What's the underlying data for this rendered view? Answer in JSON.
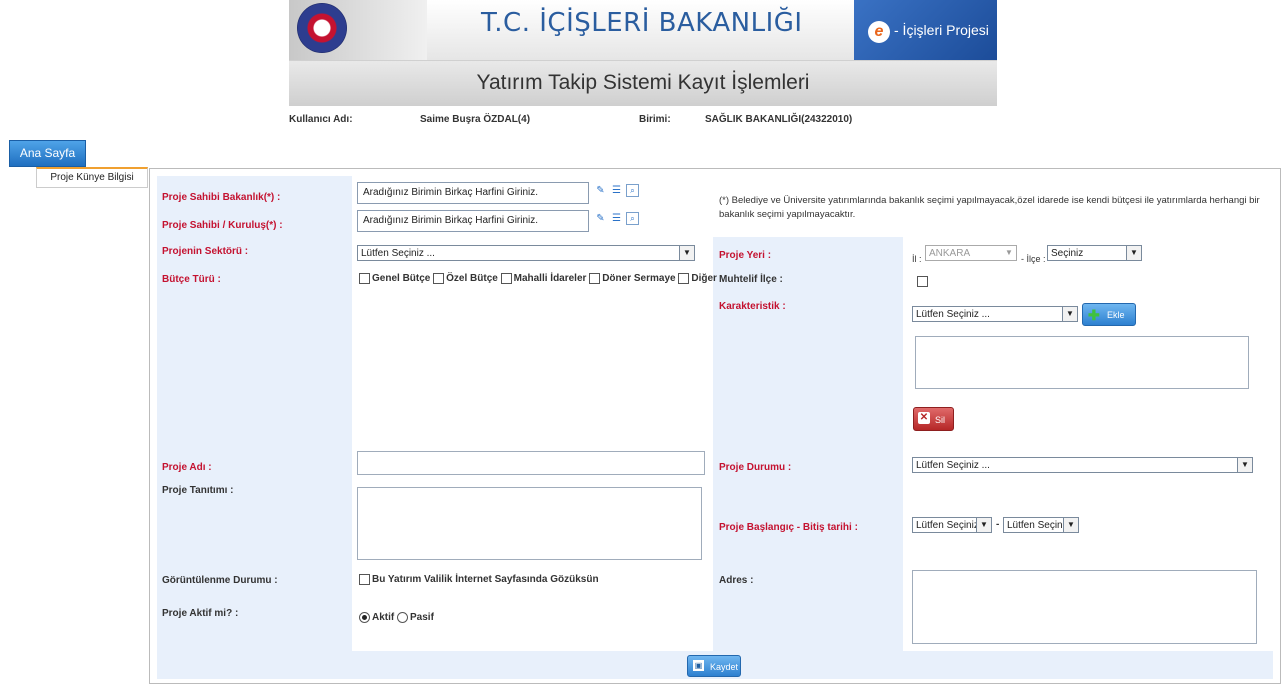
{
  "header": {
    "main_title": "T.C. İÇİŞLERİ BAKANLIĞI",
    "project_label": "- İçişleri Projesi",
    "e_letter": "e",
    "sub_title": "Yatırım Takip Sistemi Kayıt İşlemleri"
  },
  "user": {
    "username_label": "Kullanıcı Adı:",
    "username": "Saime Buşra ÖZDAL(4)",
    "unit_label": "Birimi:",
    "unit": "SAĞLIK BAKANLIĞI(24322010)"
  },
  "nav": {
    "home": "Ana Sayfa",
    "side_item": "Proje Künye Bilgisi"
  },
  "form": {
    "ministry_label": "Proje Sahibi Bakanlık(*) :",
    "ministry_placeholder": "Aradığınız Birimin Birkaç Harfini Giriniz.",
    "institution_label": "Proje Sahibi / Kuruluş(*) :",
    "institution_placeholder": "Aradığınız Birimin Birkaç Harfini Giriniz.",
    "note": "(*) Belediye ve Üniversite yatırımlarında bakanlık seçimi yapılmayacak,özel idarede ise kendi bütçesi ile yatırımlarda herhangi bir bakanlık seçimi yapılmayacaktır.",
    "sector_label": "Projenin Sektörü :",
    "sector_value": "Lütfen Seçiniz ...",
    "location_label": "Proje Yeri :",
    "province_label": "İl :",
    "province_value": "ANKARA",
    "district_label": "- İlçe :",
    "district_value": "Seçiniz",
    "budget_label": "Bütçe Türü :",
    "budget_options": [
      "Genel Bütçe",
      "Özel Bütçe",
      "Mahalli İdareler",
      "Döner Sermaye",
      "Diğer"
    ],
    "possible_district_label": "Muhtelif İlçe :",
    "characteristic_label": "Karakteristik :",
    "characteristic_value": "Lütfen Seçiniz ...",
    "add_button": "Ekle",
    "delete_button": "Sil",
    "name_label": "Proje Adı :",
    "status_label": "Proje Durumu :",
    "status_value": "Lütfen Seçiniz ...",
    "description_label": "Proje Tanıtımı :",
    "dates_label": "Proje Başlangıç - Bitiş tarihi :",
    "start_value": "Lütfen Seçiniz",
    "date_separator": "-",
    "end_value": "Lütfen Seçiniz",
    "visibility_label": "Görüntülenme Durumu :",
    "visibility_checkbox": "Bu Yatırım Valilik İnternet Sayfasında Gözüksün",
    "address_label": "Adres :",
    "active_label": "Proje Aktif mi? :",
    "active_option": "Aktif",
    "passive_option": "Pasif",
    "save_button": "Kaydet"
  },
  "colors": {
    "required_label": "#c41230",
    "title_blue": "#2a5d9f",
    "form_background": "#e8f0fb"
  }
}
